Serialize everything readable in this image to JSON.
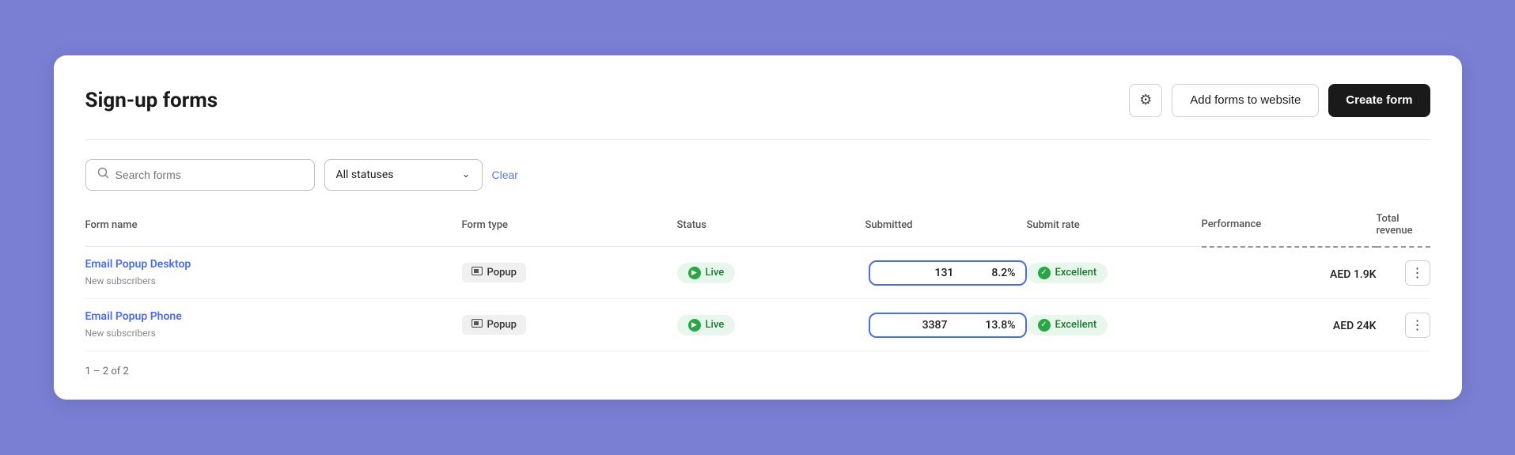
{
  "page": {
    "title": "Sign-up forms"
  },
  "header": {
    "gear_label": "⚙",
    "add_forms_label": "Add forms to website",
    "create_form_label": "Create form"
  },
  "filters": {
    "search_placeholder": "Search forms",
    "status_label": "All statuses",
    "clear_label": "Clear"
  },
  "table": {
    "columns": [
      {
        "key": "name",
        "label": "Form name"
      },
      {
        "key": "type",
        "label": "Form type"
      },
      {
        "key": "status",
        "label": "Status"
      },
      {
        "key": "submitted",
        "label": "Submitted"
      },
      {
        "key": "rate",
        "label": "Submit rate"
      },
      {
        "key": "performance",
        "label": "Performance"
      },
      {
        "key": "revenue",
        "label": "Total revenue"
      }
    ],
    "rows": [
      {
        "name": "Email Popup Desktop",
        "sub": "New subscribers",
        "type": "Popup",
        "status": "Live",
        "submitted": "131",
        "rate": "8.2%",
        "performance": "Excellent",
        "revenue": "AED 1.9K"
      },
      {
        "name": "Email Popup Phone",
        "sub": "New subscribers",
        "type": "Popup",
        "status": "Live",
        "submitted": "3387",
        "rate": "13.8%",
        "performance": "Excellent",
        "revenue": "AED 24K"
      }
    ],
    "pagination": "1 – 2 of 2"
  }
}
